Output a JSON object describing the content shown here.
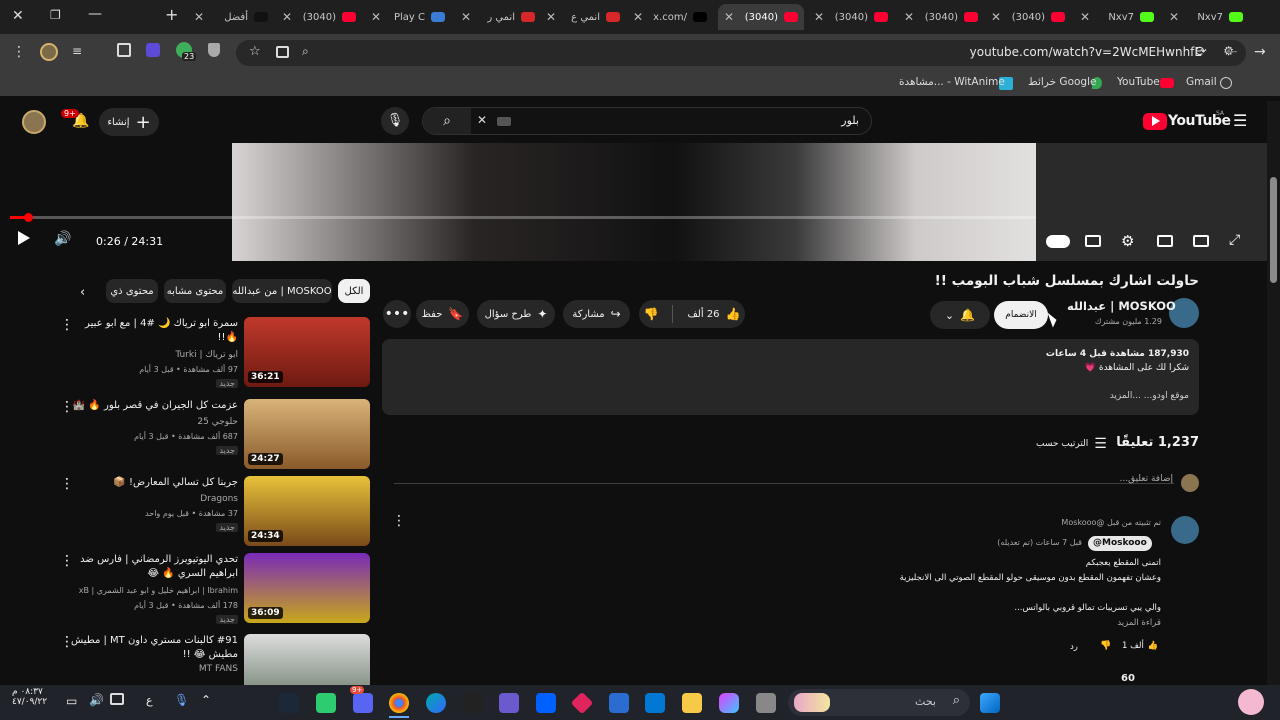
{
  "browser": {
    "tabs": [
      {
        "label": "أفضل",
        "favicon": "tiktok",
        "active": false
      },
      {
        "label": "(3040)",
        "favicon": "youtube",
        "active": false
      },
      {
        "label": "Play C",
        "favicon": "play",
        "active": false
      },
      {
        "label": "انمي ر",
        "favicon": "top",
        "active": false
      },
      {
        "label": "انمي ع",
        "favicon": "top",
        "active": false
      },
      {
        "label": "x.com/",
        "favicon": "x",
        "active": false
      },
      {
        "label": "(3040)",
        "favicon": "youtube",
        "active": true
      },
      {
        "label": "(3040)",
        "favicon": "youtube",
        "active": false
      },
      {
        "label": "(3040)",
        "favicon": "youtube",
        "active": false
      },
      {
        "label": "(3040)",
        "favicon": "youtube",
        "active": false
      },
      {
        "label": "Nxv7",
        "favicon": "kick",
        "active": false
      },
      {
        "label": "Nxv7",
        "favicon": "kick",
        "active": false
      }
    ],
    "url": "youtube.com/watch?v=2WcMEHwnhfE",
    "extension_badge": "23",
    "bookmarks": [
      {
        "label": "Gmail"
      },
      {
        "label": "YouTube"
      },
      {
        "label": "خرائط Google"
      },
      {
        "label": "مشاهدة... - WitAnime"
      }
    ]
  },
  "youtube": {
    "logo_text": "YouTube",
    "region": "SA",
    "search_value": "بلور",
    "create_label": "إنشاء",
    "notif_count": "9+",
    "player": {
      "time": "0:26 / 24:31",
      "progress_fraction": 0.018
    },
    "video": {
      "title": "حاولت اشارك بمسلسل شباب البومب !!",
      "channel": "عبدالله | MOSKOO",
      "subscribers": "1.29 مليون مشترك",
      "join_label": "الانضمام",
      "likes": "26 ألف",
      "share_label": "مشاركة",
      "ask_label": "طرح سؤال",
      "save_label": "حفظ",
      "views_line": "187,930 مشاهدة قبل 4 ساعات",
      "desc_line1": "شكرا لك على المشاهدة 💗",
      "desc_more": "موقع اودو... ...المزيد"
    },
    "comments": {
      "count": "1,237 تعليقًا",
      "sort_label": "الترتيب حسب",
      "add_placeholder": "إضافة تعليق...",
      "pinned_label": "تم تثبيته من قبل @Moskooo",
      "author": "@Moskooo",
      "time": "قبل 7 ساعات (تم تعديله)",
      "lines": [
        "اتمنى المقطع يعجبكم",
        "وعشان تفهمون المقطع بدون موسيقى حولو المقطع الصوتي الى الانجليزية",
        "",
        "والي يبي تسريبات تمالو قروبي بالواتس..."
      ],
      "read_more": "قراءة المزيد",
      "like_count": "1 ألف",
      "reply_label": "رد",
      "next_count": "60"
    },
    "chips": [
      "الكل",
      "من عبدالله | MOSKOO",
      "محتوى مشابه",
      "محتوى ذي"
    ],
    "related": [
      {
        "title": "سمرة ابو ترياك 🌙 #4 | مع ابو عبير 🔥!!",
        "channel": "ابو ترياك | Turki",
        "meta": "97 ألف مشاهدة • قبل 3 أيام",
        "duration": "36:21",
        "new": "جديد"
      },
      {
        "title": "عزمت كل الجيران في قصر بلور 🔥 🏰",
        "channel": "حلوجي 25",
        "meta": "687 ألف مشاهدة • قبل 3 أيام",
        "duration": "24:27",
        "new": "جديد"
      },
      {
        "title": "جربنا كل تسالي المعارض! 📦",
        "channel": "Dragons",
        "meta": "37 مشاهدة • قبل يوم واحد",
        "duration": "24:34",
        "new": "جديد"
      },
      {
        "title": "تحدي اليوتيوبرز الرمضاني | فارس ضد ابراهيم السري 🔥 😂",
        "channel": "Ibrahim | ابراهيم خليل و ابو عبد الشمري | xB",
        "meta": "178 ألف مشاهدة • قبل 3 أيام",
        "duration": "36:09",
        "new": "جديد"
      },
      {
        "title": "#91 كالبنات مستري داون MT | مطيش مطيش 😂 !!",
        "channel": "MT FANS",
        "meta": "",
        "duration": "",
        "new": ""
      }
    ]
  },
  "taskbar": {
    "search_placeholder": "بحث",
    "time": "٠٨:٣٧ م",
    "date": "٤٧/٠٩/٢٢",
    "lang": "ع",
    "discord_badge": "9+"
  }
}
